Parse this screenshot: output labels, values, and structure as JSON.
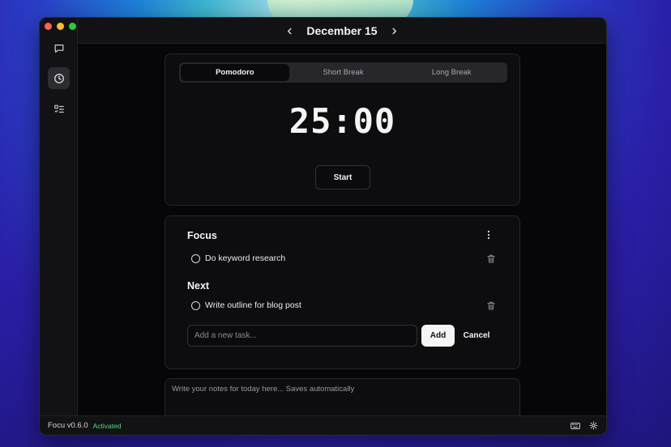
{
  "app": {
    "header": {
      "prev_icon": "chevron-left-icon",
      "date": "December 15",
      "next_icon": "chevron-right-icon"
    },
    "sidebar": {
      "items": [
        {
          "icon": "chat-icon",
          "active": false
        },
        {
          "icon": "clock-icon",
          "active": true
        },
        {
          "icon": "checklist-icon",
          "active": false
        }
      ]
    },
    "timer": {
      "tabs": [
        {
          "label": "Pomodoro",
          "active": true
        },
        {
          "label": "Short Break",
          "active": false
        },
        {
          "label": "Long Break",
          "active": false
        }
      ],
      "time": "25:00",
      "start_label": "Start"
    },
    "tasks": {
      "focus_title": "Focus",
      "focus_items": [
        {
          "label": "Do keyword research",
          "done": false
        }
      ],
      "next_title": "Next",
      "next_items": [
        {
          "label": "Write outline for blog post",
          "done": false
        }
      ],
      "new_task_placeholder": "Add a new task...",
      "add_label": "Add",
      "cancel_label": "Cancel"
    },
    "notes": {
      "placeholder": "Write your notes for today here... Saves automatically"
    },
    "status": {
      "version": "Focu v0.6.0",
      "license": "Activated",
      "icons": [
        "keyboard-icon",
        "gear-icon"
      ]
    }
  },
  "colors": {
    "accent": "#f5f5f5",
    "status_green": "#4ade80",
    "background": "#060608"
  }
}
